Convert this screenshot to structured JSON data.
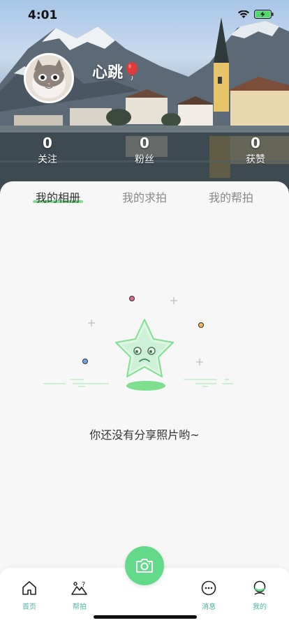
{
  "status_bar": {
    "time": "4:01"
  },
  "profile": {
    "username": "心跳",
    "stats": [
      {
        "key": "following",
        "value": "0",
        "label": "关注"
      },
      {
        "key": "fans",
        "value": "0",
        "label": "粉丝"
      },
      {
        "key": "likes",
        "value": "0",
        "label": "获赞"
      }
    ]
  },
  "tabs": [
    {
      "label": "我的相册",
      "active": true
    },
    {
      "label": "我的求拍",
      "active": false
    },
    {
      "label": "我的帮拍",
      "active": false
    }
  ],
  "empty_state": {
    "message": "你还没有分享照片哟~"
  },
  "tabbar": {
    "items": [
      {
        "label": "首页",
        "icon": "home-icon"
      },
      {
        "label": "帮拍",
        "icon": "help-shoot-icon"
      },
      {
        "label": "消息",
        "icon": "message-icon"
      },
      {
        "label": "我的",
        "icon": "profile-icon"
      }
    ],
    "center_icon": "camera-icon"
  },
  "colors": {
    "accent": "#63d98a",
    "tab_label": "#4fb5a6"
  }
}
